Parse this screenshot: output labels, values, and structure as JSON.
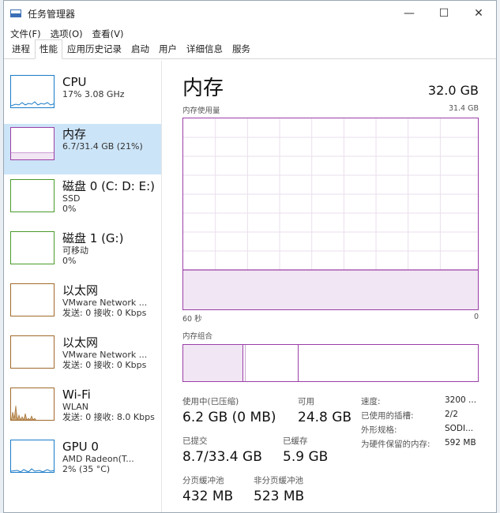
{
  "window": {
    "title": "任务管理器",
    "minimize": "—",
    "maximize": "☐",
    "close": "✕"
  },
  "menu": [
    "文件(F)",
    "选项(O)",
    "查看(V)"
  ],
  "tabs": [
    "进程",
    "性能",
    "应用历史记录",
    "启动",
    "用户",
    "详细信息",
    "服务"
  ],
  "active_tab": "性能",
  "sidebar": {
    "items": [
      {
        "title": "CPU",
        "sub1": "17% 3.08 GHz",
        "sub2": "",
        "thumb_color": "#1a7bc7"
      },
      {
        "title": "内存",
        "sub1": "6.7/31.4 GB (21%)",
        "sub2": "",
        "thumb_color": "#9b3fa8",
        "selected": true
      },
      {
        "title": "磁盘 0 (C: D: E:)",
        "sub1": "SSD",
        "sub2": "0%",
        "thumb_color": "#4a9a2a"
      },
      {
        "title": "磁盘 1 (G:)",
        "sub1": "可移动",
        "sub2": "0%",
        "thumb_color": "#4a9a2a"
      },
      {
        "title": "以太网",
        "sub1": "VMware Network ...",
        "sub2": "发送: 0 接收: 0 Kbps",
        "thumb_color": "#a0692a"
      },
      {
        "title": "以太网",
        "sub1": "VMware Network ...",
        "sub2": "发送: 0 接收: 0 Kbps",
        "thumb_color": "#a0692a"
      },
      {
        "title": "Wi-Fi",
        "sub1": "WLAN",
        "sub2": "发送: 0 接收: 8.0 Kbps",
        "thumb_color": "#a0692a"
      },
      {
        "title": "GPU 0",
        "sub1": "AMD Radeon(T...",
        "sub2": "2% (35 °C)",
        "thumb_color": "#1a7bc7"
      }
    ]
  },
  "main": {
    "title": "内存",
    "total": "32.0 GB",
    "usage_label": "内存使用量",
    "usage_max": "31.4 GB",
    "axis_left": "60 秒",
    "axis_right": "0",
    "composition_label": "内存组合",
    "usage_fraction": 0.21,
    "stats": {
      "in_use_label": "使用中(已压缩)",
      "in_use_value": "6.2 GB (0 MB)",
      "available_label": "可用",
      "available_value": "24.8 GB",
      "committed_label": "已提交",
      "committed_value": "8.7/33.4 GB",
      "cached_label": "已缓存",
      "cached_value": "5.9 GB",
      "paged_label": "分页缓冲池",
      "paged_value": "432 MB",
      "nonpaged_label": "非分页缓冲池",
      "nonpaged_value": "523 MB"
    },
    "details": {
      "speed_label": "速度:",
      "speed_value": "3200 ...",
      "slots_label": "已使用的插槽:",
      "slots_value": "2/2",
      "form_label": "外形规格:",
      "form_value": "SODI...",
      "reserved_label": "为硬件保留的内存:",
      "reserved_value": "592 MB"
    }
  }
}
